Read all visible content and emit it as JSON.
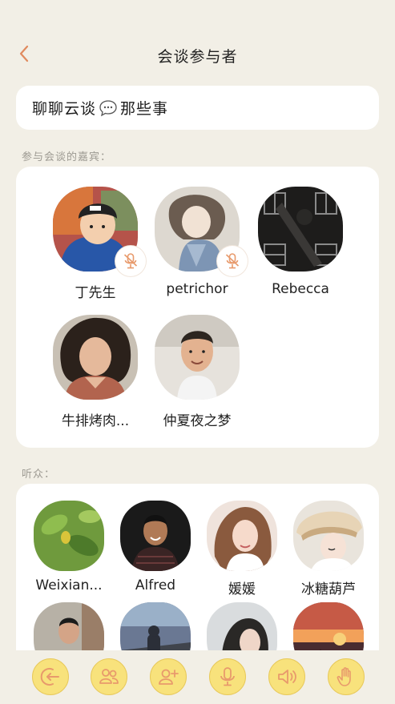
{
  "header": {
    "title": "会谈参与者"
  },
  "topic": {
    "text_before": "聊聊云谈",
    "text_after": "那些事"
  },
  "guests_section": {
    "label": "参与会谈的嘉宾：",
    "guests": [
      {
        "name": "丁先生",
        "muted": true
      },
      {
        "name": "petrichor",
        "muted": true
      },
      {
        "name": "Rebecca",
        "muted": false
      },
      {
        "name": "牛排烤肉...",
        "muted": false
      },
      {
        "name": "仲夏夜之梦",
        "muted": false
      }
    ]
  },
  "listeners_section": {
    "label": "听众：",
    "listeners": [
      {
        "name": "Weixian..."
      },
      {
        "name": "Alfred"
      },
      {
        "name": "媛媛"
      },
      {
        "name": "冰糖葫芦"
      },
      {
        "name": ""
      },
      {
        "name": ""
      },
      {
        "name": ""
      },
      {
        "name": ""
      }
    ]
  },
  "toolbar": {
    "buttons": [
      "leave-icon",
      "participants-icon",
      "invite-icon",
      "microphone-icon",
      "speaker-icon",
      "raise-hand-icon"
    ]
  },
  "colors": {
    "background": "#f2efe6",
    "card": "#ffffff",
    "accent_yellow": "#f8e27c",
    "accent_orange": "#e89a6c",
    "muted_text": "#9d9a92"
  }
}
